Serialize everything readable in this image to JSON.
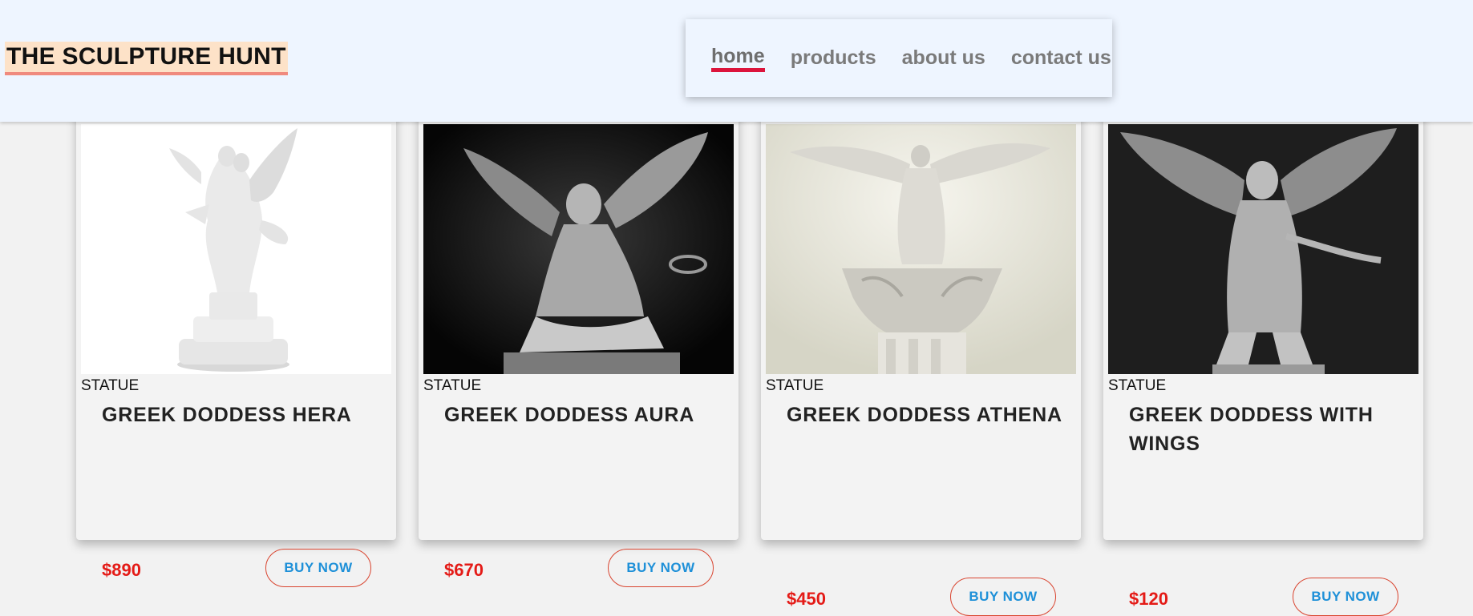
{
  "header": {
    "logo": "THE SCULPTURE HUNT",
    "nav": [
      {
        "label": "home",
        "active": true
      },
      {
        "label": "products",
        "active": false
      },
      {
        "label": "about us",
        "active": false
      },
      {
        "label": "contact us",
        "active": false
      }
    ]
  },
  "products": [
    {
      "category": "STATUE",
      "title": "GREEK DODDESS HERA",
      "price": "$890",
      "button": "BUY NOW",
      "image_icon": "winged-couple-statue-image"
    },
    {
      "category": "STATUE",
      "title": "GREEK DODDESS AURA",
      "price": "$670",
      "button": "BUY NOW",
      "image_icon": "seated-angel-statue-image"
    },
    {
      "category": "STATUE",
      "title": "GREEK DODDESS ATHENA",
      "price": "$450",
      "button": "BUY NOW",
      "image_icon": "angel-on-column-statue-image"
    },
    {
      "category": "STATUE",
      "title": "GREEK DODDESS WITH WINGS",
      "price": "$120",
      "button": "BUY NOW",
      "image_icon": "winged-warrior-statue-image"
    }
  ],
  "colors": {
    "header_bg": "#eef5ff",
    "price": "#e41b17",
    "button_text": "#1e90d8",
    "button_border": "#d9442f",
    "nav_active_underline": "#dc143c",
    "logo_highlight": "#fde2c8"
  }
}
